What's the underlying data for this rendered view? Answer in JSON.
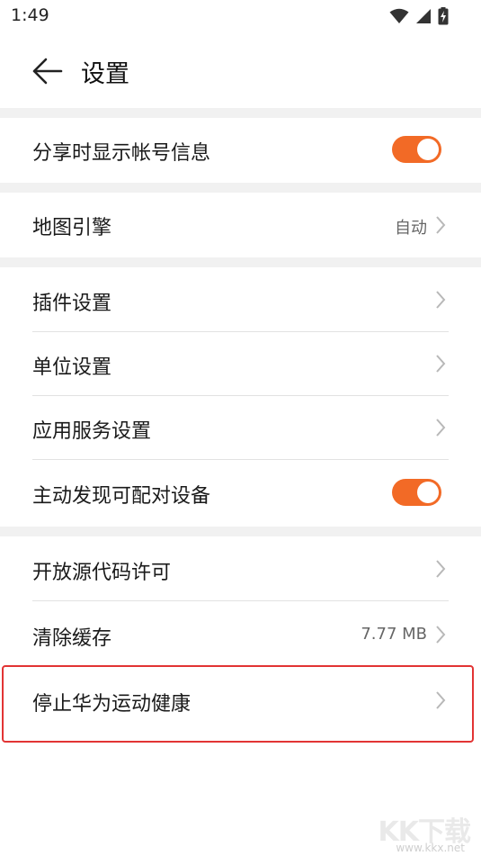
{
  "status_bar": {
    "time": "1:49",
    "icons": [
      "wifi-icon",
      "signal-icon",
      "battery-charging-icon"
    ]
  },
  "header": {
    "back_icon": "arrow-left-icon",
    "title": "设置"
  },
  "settings": {
    "share_account_info": {
      "label": "分享时显示帐号信息",
      "toggle_on": true
    },
    "map_engine": {
      "label": "地图引擎",
      "value": "自动"
    },
    "plugin_settings": {
      "label": "插件设置"
    },
    "unit_settings": {
      "label": "单位设置"
    },
    "app_service_settings": {
      "label": "应用服务设置"
    },
    "discover_devices": {
      "label": "主动发现可配对设备",
      "toggle_on": true
    },
    "open_source_license": {
      "label": "开放源代码许可"
    },
    "clear_cache": {
      "label": "清除缓存",
      "value": "7.77 MB"
    },
    "stop_health": {
      "label": "停止华为运动健康"
    }
  },
  "watermark": {
    "logo": "KK下载",
    "url": "www.kkx.net"
  },
  "colors": {
    "accent": "#f26a26",
    "highlight_border": "#e23434",
    "section_gap": "#f1f1f1"
  }
}
